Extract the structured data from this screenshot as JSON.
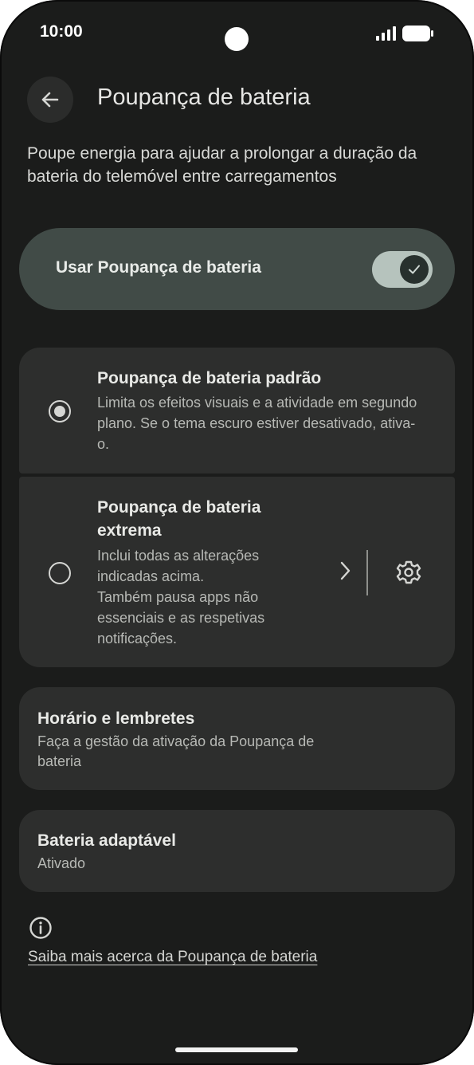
{
  "status_bar": {
    "time": "10:00"
  },
  "header": {
    "title": "Poupança de bateria"
  },
  "description": "Poupe energia para ajudar a prolongar a duração da bateria do telemóvel entre carregamentos",
  "main_toggle": {
    "label": "Usar Poupança de bateria",
    "state": "on"
  },
  "options": [
    {
      "title": "Poupança de bateria padrão",
      "description": "Limita os efeitos visuais e a atividade em segundo plano. Se o tema escuro estiver desativado, ativa-o.",
      "selected": true
    },
    {
      "title_line1": "Poupança de bateria",
      "title_line2": "extrema",
      "description_lines": [
        "Inclui todas as alterações",
        "indicadas acima.",
        "Também pausa apps não",
        "essenciais e as respetivas",
        "notificações."
      ],
      "selected": false
    }
  ],
  "schedule": {
    "title": "Horário e lembretes",
    "subtitle_line1": "Faça a gestão da ativação da Poupança de",
    "subtitle_line2": "bateria"
  },
  "adaptive": {
    "title": "Bateria adaptável",
    "subtitle": "Ativado"
  },
  "learn_more": "Saiba mais acerca da Poupança de bateria",
  "colors": {
    "background": "#1b1c1b",
    "card": "#2d2e2d",
    "toggle_card": "#414b47",
    "switch_track": "#b6c3bd"
  },
  "icons": [
    "back-arrow-icon",
    "check-icon",
    "chevron-right-icon",
    "gear-icon",
    "info-icon",
    "signal-icon",
    "battery-icon"
  ]
}
